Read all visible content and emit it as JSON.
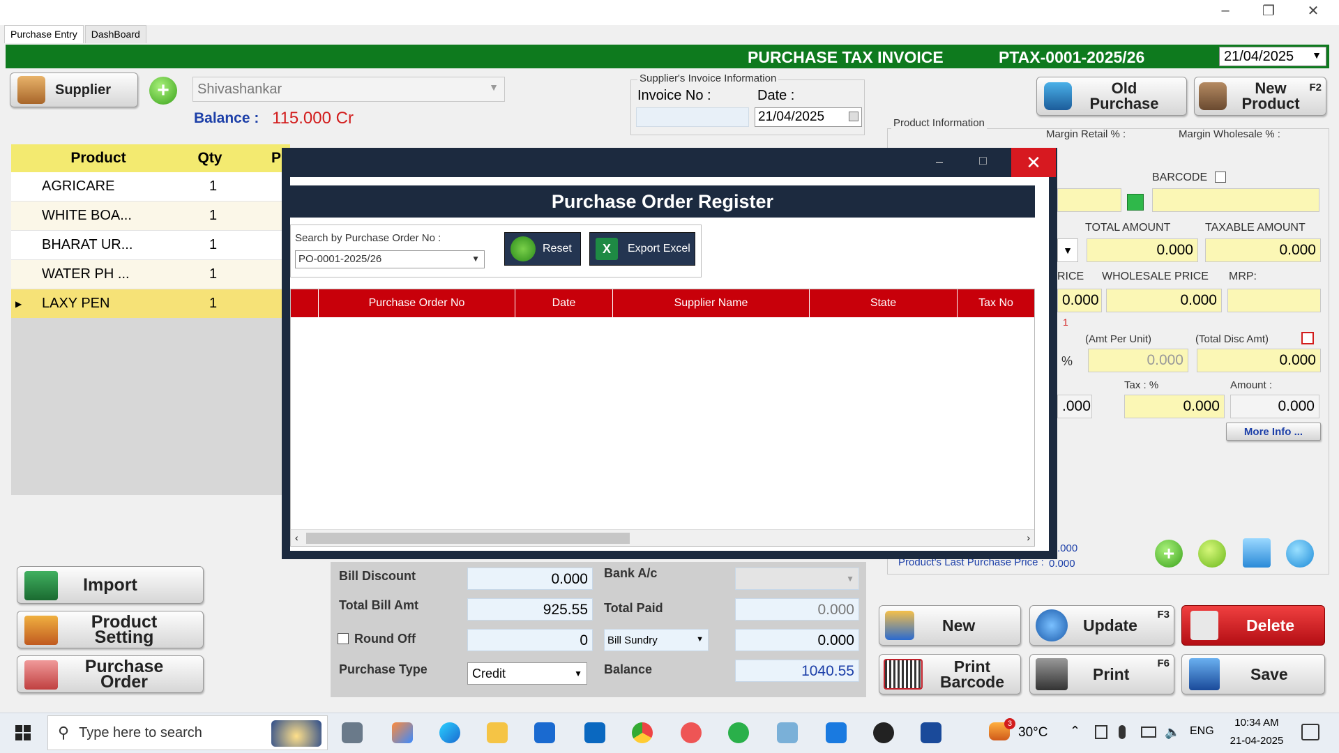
{
  "window": {
    "minimize": "–",
    "restore": "❐",
    "close": "✕"
  },
  "tabs": [
    {
      "label": "Purchase Entry"
    },
    {
      "label": "DashBoard"
    }
  ],
  "header": {
    "title": "PURCHASE TAX INVOICE",
    "invoice_no": "PTAX-0001-2025/26",
    "date": "21/04/2025"
  },
  "supplier": {
    "button": "Supplier",
    "name": "Shivashankar",
    "balance_label": "Balance :",
    "balance_value": "115.000 Cr"
  },
  "supplier_invoice": {
    "group_label": "Supplier's Invoice Information",
    "invoice_label": "Invoice No :",
    "date_label": "Date :",
    "date_value": "21/04/2025"
  },
  "product_table": {
    "headers": [
      "Product",
      "Qty",
      "P"
    ],
    "rows": [
      {
        "product": "AGRICARE",
        "qty": "1"
      },
      {
        "product": "WHITE BOA...",
        "qty": "1"
      },
      {
        "product": "BHARAT UR...",
        "qty": "1"
      },
      {
        "product": "WATER PH ...",
        "qty": "1"
      },
      {
        "product": "LAXY PEN",
        "qty": "1"
      }
    ]
  },
  "right_panel": {
    "old_purchase": "Old Purchase",
    "new_product": "New Product",
    "new_product_key": "F2",
    "product_info_label": "Product Information",
    "margin_retail": "Margin Retail % :",
    "margin_wholesale": "Margin Wholesale % :",
    "barcode_label": "BARCODE",
    "total_amount_label": "TOTAL AMOUNT",
    "total_amount": "0.000",
    "taxable_amount_label": "TAXABLE AMOUNT",
    "taxable_amount": "0.000",
    "price_label_partial": "RICE",
    "price_partial": "0.000",
    "wholesale_price_label": "WHOLESALE PRICE",
    "wholesale_price": "0.000",
    "mrp_label": "MRP:",
    "red_one": "1",
    "amt_per_unit_label": "(Amt Per Unit)",
    "total_disc_amt_label": "(Total Disc Amt)",
    "percent_sign": "%",
    "amt_per_unit": "0.000",
    "total_disc_amt": "0.000",
    "tax_label": "Tax : %",
    "amount_label": "Amount :",
    "partial_value": ".000",
    "tax_value": "0.000",
    "amount_value": "0.000",
    "more_info": "More Info ...",
    "last_price_partial": ".000",
    "last_price_label": "Product's Last Purchase Price :",
    "last_price_value": "0.000"
  },
  "modal": {
    "title": "Purchase Order Register",
    "search_label": "Search by Purchase Order No :",
    "search_value": "PO-0001-2025/26",
    "reset": "Reset",
    "export": "Export Excel",
    "columns": [
      "Purchase Order No",
      "Date",
      "Supplier Name",
      "State",
      "Tax No"
    ]
  },
  "bottom": {
    "bill_discount_label": "Bill Discount",
    "bill_discount": "0.000",
    "bank_label": "Bank A/c",
    "total_bill_label": "Total Bill Amt",
    "total_bill": "925.55",
    "total_paid_label": "Total Paid",
    "total_paid": "0.000",
    "round_off_label": "Round Off",
    "round_off": "0",
    "bill_sundry_label": "Bill Sundry",
    "bill_sundry": "0.000",
    "purchase_type_label": "Purchase Type",
    "purchase_type": "Credit",
    "balance_label": "Balance",
    "balance": "1040.55"
  },
  "left_buttons": {
    "import": "Import",
    "product_setting": "Product Setting",
    "purchase_order": "Purchase Order"
  },
  "action_buttons": {
    "new": "New",
    "update": "Update",
    "update_key": "F3",
    "delete": "Delete",
    "print_barcode": "Print Barcode",
    "print": "Print",
    "print_key": "F6",
    "save": "Save"
  },
  "taskbar": {
    "search_placeholder": "Type here to search",
    "temperature": "30°C",
    "weather_badge": "3",
    "language": "ENG",
    "time": "10:34 AM",
    "date": "21-04-2025"
  },
  "colors": {
    "green_header": "#0e7a1e",
    "modal_dark": "#1c2a3f",
    "table_header_red": "#c8000a",
    "delete_red": "#d71920",
    "field_yellow": "#fbf7b5"
  }
}
